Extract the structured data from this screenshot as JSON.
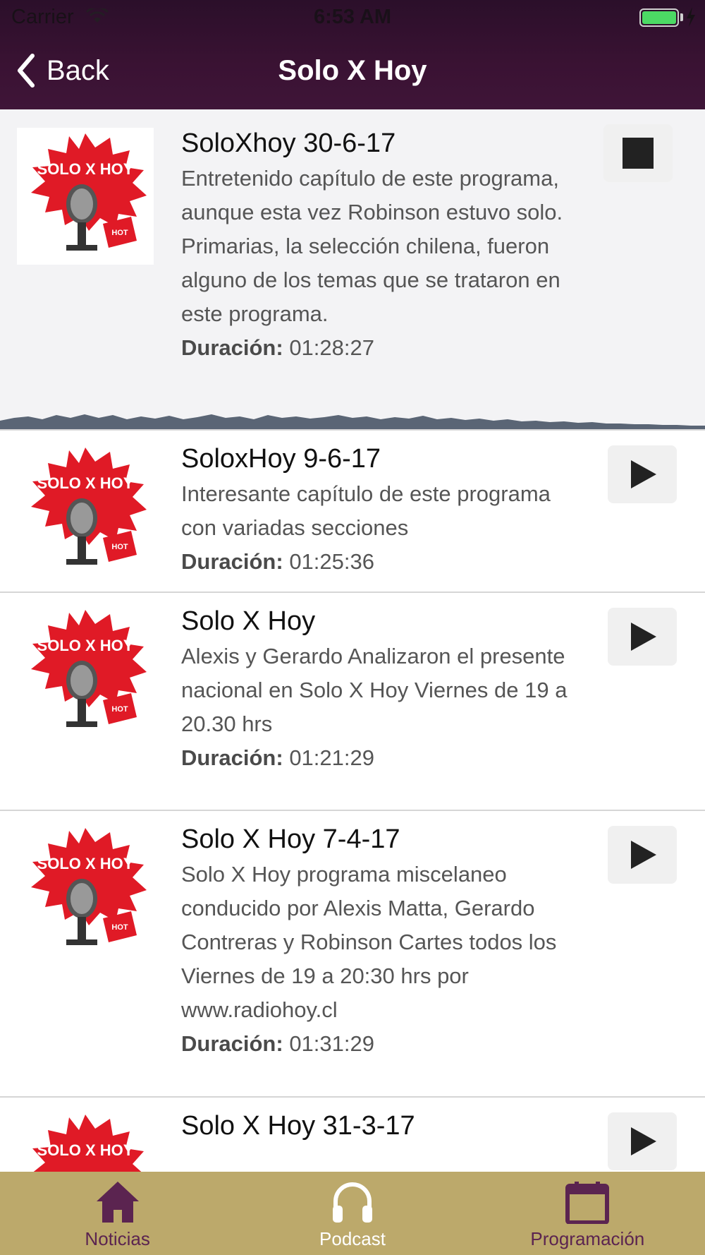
{
  "status": {
    "carrier": "Carrier",
    "time": "6:53 AM"
  },
  "nav": {
    "back_label": "Back",
    "title": "Solo X Hoy"
  },
  "episodes": [
    {
      "title": "SoloXhoy 30-6-17",
      "description": "Entretenido capítulo de este programa, aunque esta vez Robinson estuvo solo. Primarias, la selección chilena, fueron alguno de los temas que se trataron en este programa.",
      "duration_label": "Duración:",
      "duration": "01:28:27",
      "state": "playing"
    },
    {
      "title": "SoloxHoy 9-6-17",
      "description": "Interesante capítulo de este programa con variadas secciones",
      "duration_label": "Duración:",
      "duration": "01:25:36",
      "state": "paused"
    },
    {
      "title": "Solo X Hoy",
      "description": "Alexis y Gerardo Analizaron el presente nacional en Solo X Hoy Viernes de 19 a 20.30 hrs",
      "duration_label": "Duración:",
      "duration": "01:21:29",
      "state": "paused"
    },
    {
      "title": "Solo X Hoy 7-4-17",
      "description": "Solo X Hoy programa miscelaneo conducido por Alexis Matta, Gerardo Contreras y Robinson Cartes todos los Viernes de 19 a 20:30 hrs por www.radiohoy.cl",
      "duration_label": "Duración:",
      "duration": "01:31:29",
      "state": "paused"
    },
    {
      "title": "Solo X Hoy 31-3-17",
      "state": "paused"
    }
  ],
  "tabbar": {
    "tabs": [
      {
        "label": "Noticias",
        "icon": "house-icon"
      },
      {
        "label": "Podcast",
        "icon": "headphones-icon",
        "selected": true
      },
      {
        "label": "Programación",
        "icon": "calendar-icon"
      }
    ]
  },
  "colors": {
    "header": "#3a1233",
    "tabbar": "#bca96b",
    "tab_icon": "#5b2450",
    "tab_selected": "#ffffff"
  }
}
